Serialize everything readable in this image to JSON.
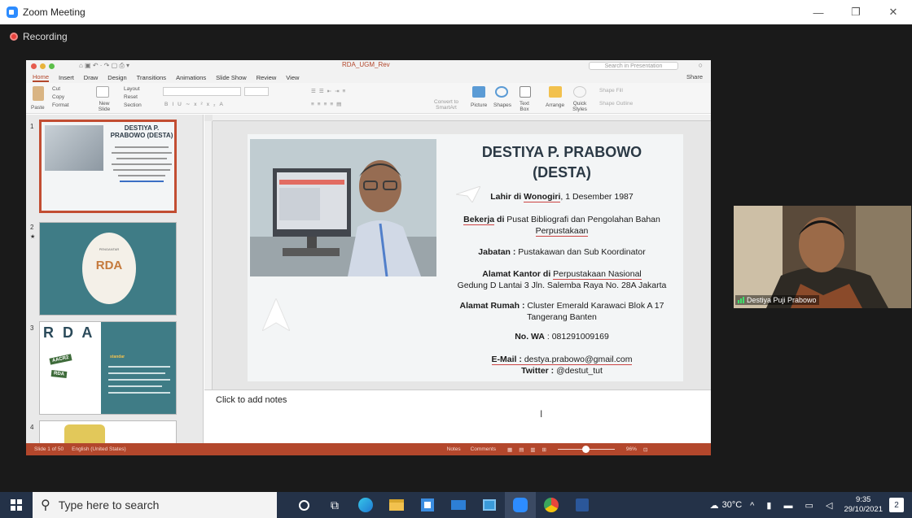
{
  "window": {
    "title": "Zoom Meeting",
    "controls": [
      "—",
      "❐",
      "✕"
    ]
  },
  "recording": {
    "label": "Recording"
  },
  "ppt": {
    "filename": "RDA_UGM_Rev",
    "search_placeholder": "Search in Presentation",
    "tabs": [
      "Home",
      "Insert",
      "Draw",
      "Design",
      "Transitions",
      "Animations",
      "Slide Show",
      "Review",
      "View"
    ],
    "share_label": "Share",
    "ribbon": {
      "paste": "Paste",
      "cut": "Cut",
      "copy": "Copy",
      "format": "Format",
      "new_slide": "New Slide",
      "layout": "Layout",
      "reset": "Reset",
      "section": "Section",
      "convert": "Convert to SmartArt",
      "picture": "Picture",
      "shapes": "Shapes",
      "textbox": "Text Box",
      "arrange": "Arrange",
      "quick_styles": "Quick Styles",
      "shape_fill": "Shape Fill",
      "shape_outline": "Shape Outline"
    },
    "thumbnails": [
      {
        "num": "1",
        "title": "DESTIYA P. PRABOWO (DESTA)"
      },
      {
        "num": "2",
        "star": "★",
        "title": "RDA",
        "top": "PENGANTAR"
      },
      {
        "num": "3",
        "title": "R D A",
        "tag1": "AACR2",
        "tag2": "RDA",
        "highlight": "standar"
      },
      {
        "num": "4"
      }
    ],
    "slide": {
      "name_line1": "DESTIYA P. PRABOWO",
      "name_line2": "(DESTA)",
      "birth_a": "Lahir di ",
      "birth_b": "Wonogiri",
      "birth_c": ", 1 Desember 1987",
      "work_a": "Bekerja",
      "work_b": " di ",
      "work_c": "Pusat Bibliografi dan Pengolahan Bahan",
      "work_d": "Perpustakaan",
      "job_a": "Jabatan : ",
      "job_b": "Pustakawan dan Sub Koordinator",
      "office_a": "Alamat Kantor",
      "office_b": " di ",
      "office_c": "Perpustakaan Nasional",
      "office_d": "Gedung D Lantai 3 Jln. Salemba Raya No. 28A Jakarta",
      "home_a": "Alamat Rumah : ",
      "home_b": "Cluster Emerald Karawaci Blok A 17",
      "home_c": "Tangerang Banten",
      "wa_a": "No. WA",
      "wa_b": "   : 081291009169",
      "email_a": "E-Mail : ",
      "email_b": "destya.prabowo@gmail.com",
      "twitter_a": "Twitter : ",
      "twitter_b": "@destut_tut"
    },
    "notes_placeholder": "Click to add notes",
    "status": {
      "slide": "Slide 1 of 50",
      "lang": "English (United States)",
      "notes": "Notes",
      "comments": "Comments",
      "zoom": "96%"
    }
  },
  "participant": {
    "name": "Destiya Puji Prabowo"
  },
  "taskbar": {
    "search_placeholder": "Type here to search",
    "weather": "30°C",
    "time": "9:35",
    "date": "29/10/2021",
    "notif_count": "2"
  },
  "colors": {
    "ppt_accent": "#b3472c",
    "taskbar": "#243248",
    "zoom_blue": "#2d8cff"
  }
}
